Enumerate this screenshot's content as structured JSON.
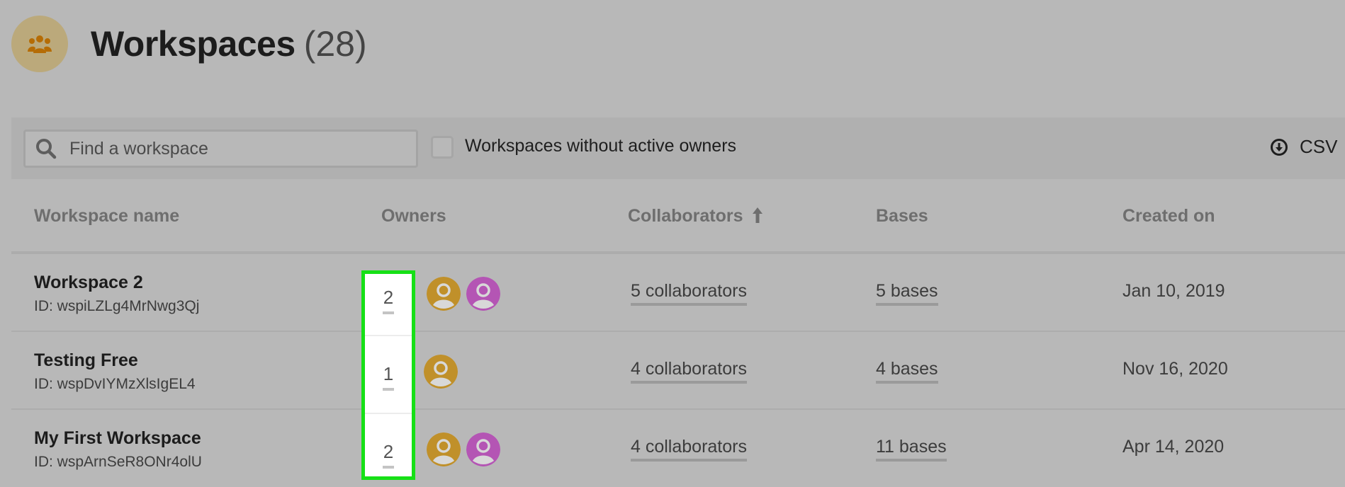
{
  "header": {
    "title": "Workspaces",
    "count": "(28)",
    "icon": "people-group-icon"
  },
  "toolbar": {
    "search_placeholder": "Find a workspace",
    "search_value": "",
    "filter_checkbox_label": "Workspaces without active owners",
    "filter_checked": false,
    "export_label": "CSV",
    "export_icon": "download-circle-icon"
  },
  "table": {
    "columns": [
      {
        "label": "Workspace name"
      },
      {
        "label": "Owners"
      },
      {
        "label": "Collaborators",
        "sort": "ascending"
      },
      {
        "label": "Bases"
      },
      {
        "label": "Created on"
      }
    ],
    "rows": [
      {
        "name": "Workspace 2",
        "id": "ID: wspiLZLg4MrNwg3Qj",
        "owners_count": "2",
        "owner_avatars": [
          "#c0902a",
          "#b455b4"
        ],
        "collaborators": "5 collaborators",
        "bases": "5 bases",
        "created_on": "Jan 10, 2019"
      },
      {
        "name": "Testing Free",
        "id": "ID: wspDvIYMzXlsIgEL4",
        "owners_count": "1",
        "owner_avatars": [
          "#c0902a"
        ],
        "collaborators": "4 collaborators",
        "bases": "4 bases",
        "created_on": "Nov 16, 2020"
      },
      {
        "name": "My First Workspace",
        "id": "ID: wspArnSeR8ONr4olU",
        "owners_count": "2",
        "owner_avatars": [
          "#c0902a",
          "#b455b4"
        ],
        "collaborators": "4 collaborators",
        "bases": "11 bases",
        "created_on": "Apr 14, 2020"
      }
    ]
  },
  "highlight": {
    "target": "owners-count-column",
    "color": "#16e016"
  }
}
